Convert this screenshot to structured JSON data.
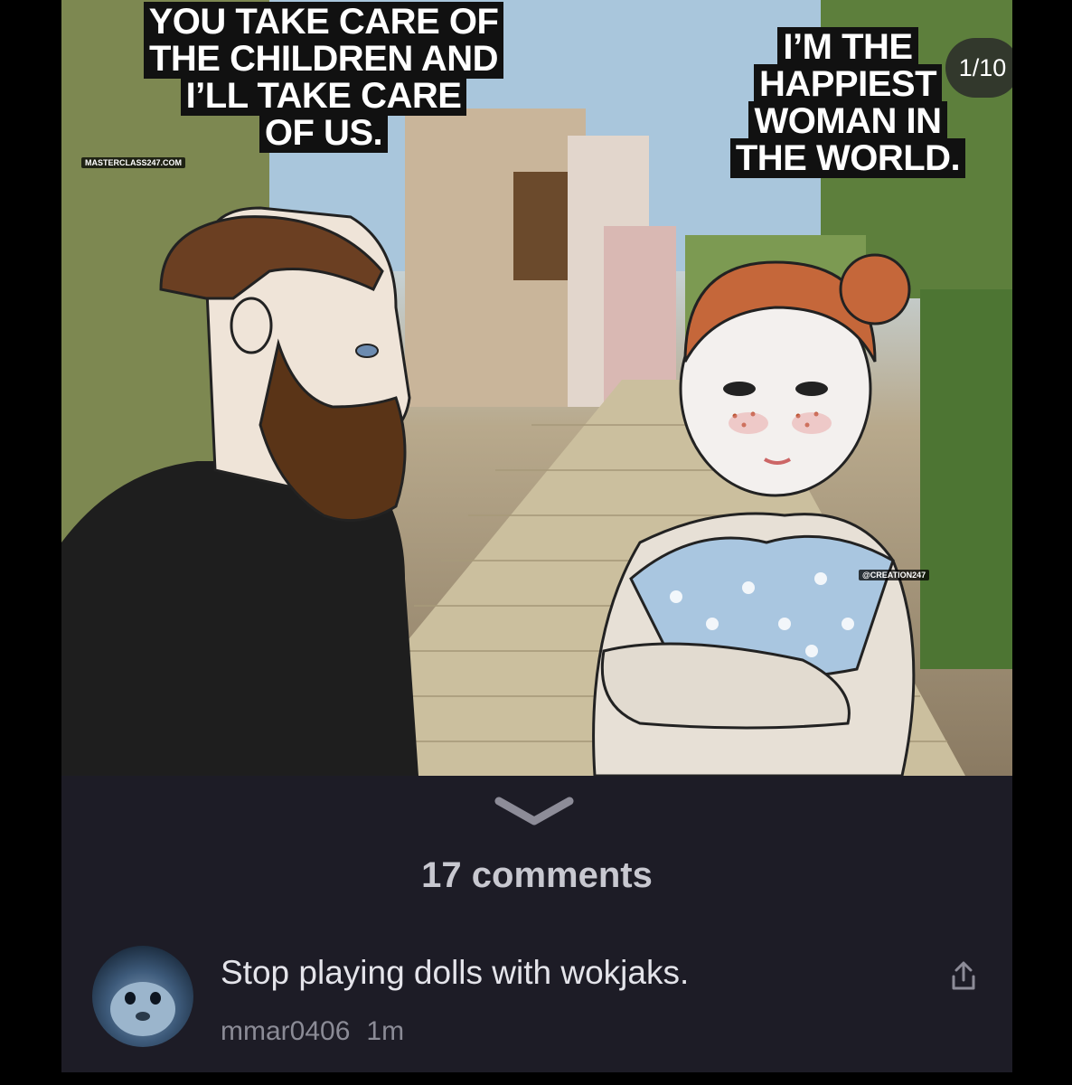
{
  "meme": {
    "caption_left": "YOU TAKE CARE OF\nTHE CHILDREN AND\nI’LL TAKE CARE\nOF US.",
    "caption_right": "I’M THE\nHAPPIEST\nWOMAN IN\nTHE WORLD.",
    "watermark_left": "MASTERCLASS247.COM",
    "watermark_right": "@CREATION247"
  },
  "carousel": {
    "counter": "1/10"
  },
  "comments": {
    "count_label": "17 comments",
    "items": [
      {
        "text": "Stop playing dolls with wokjaks.",
        "username": "mmar0406",
        "time": "1m"
      }
    ]
  },
  "icons": {
    "expand": "chevron-down-icon",
    "share": "share-icon"
  },
  "colors": {
    "panel_bg": "#1d1c26",
    "page_bg": "#000000",
    "text_primary": "#e4e4ea",
    "text_secondary": "#8b8b96"
  }
}
